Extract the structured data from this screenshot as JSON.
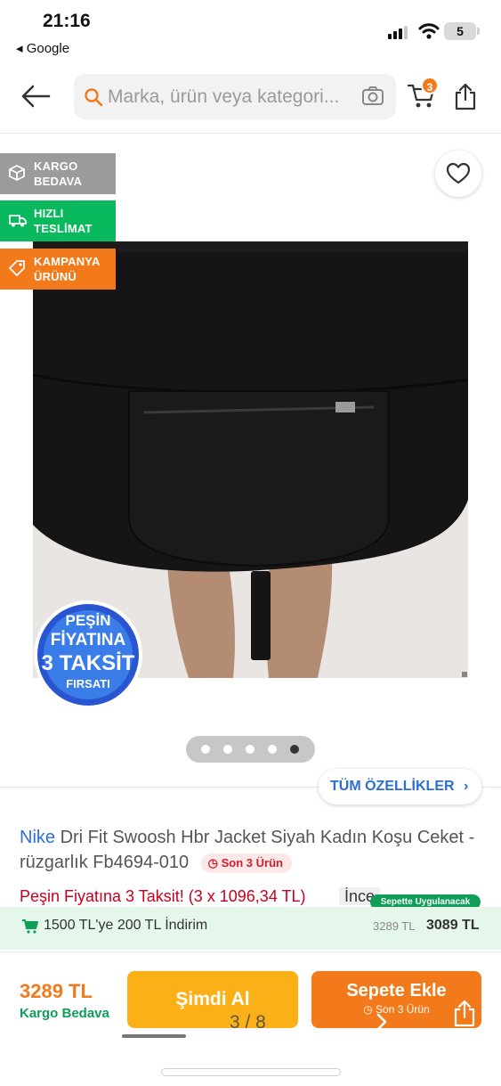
{
  "status_bar": {
    "time": "21:16",
    "back_app": "◂ Google",
    "battery": "5"
  },
  "header": {
    "search_placeholder": "Marka, ürün veya kategori...",
    "cart_count": "3"
  },
  "badges": [
    {
      "line1": "KARGO",
      "line2": "BEDAVA",
      "color": "#9b9b9b"
    },
    {
      "line1": "HIZLI",
      "line2": "TESLİMAT",
      "color": "#0ab95d"
    },
    {
      "line1": "KAMPANYA",
      "line2": "ÜRÜNÜ",
      "color": "#f27a1a"
    }
  ],
  "promo_seal": {
    "line1": "PEŞİN",
    "line2": "FİYATINA",
    "line3": "3 TAKSİT",
    "line4": "FIRSATI"
  },
  "gallery": {
    "dots": 5,
    "active_index": 4,
    "counter": "3 / 8"
  },
  "all_features": "TÜM ÖZELLİKLER",
  "product": {
    "brand": "Nike",
    "name": "Dri Fit Swoosh Hbr Jacket Siyah Kadın Koşu Ceket -rüzgarlık Fb4694-010",
    "stock_label": "Son 3 Ürün"
  },
  "installment_text": "Peşin Fiyatına 3 Taksit! (3 x 1096,34 TL)",
  "installment_more": "İnce",
  "basket_chip": "Sepette Uygulanacak",
  "discount": {
    "text": "1500 TL'ye 200 TL İndirim",
    "old_price": "3289 TL",
    "new_price": "3089 TL"
  },
  "footer": {
    "price": "3289 TL",
    "cargo": "Kargo Bedava",
    "buy_now": "Şimdi Al",
    "add_to_cart": "Sepete Ekle",
    "add_to_cart_sub": "Son 3 Ürün"
  },
  "colors": {
    "brand_orange": "#f27a1a",
    "brand_blue": "#2b6fd6",
    "green": "#0f9d58"
  }
}
